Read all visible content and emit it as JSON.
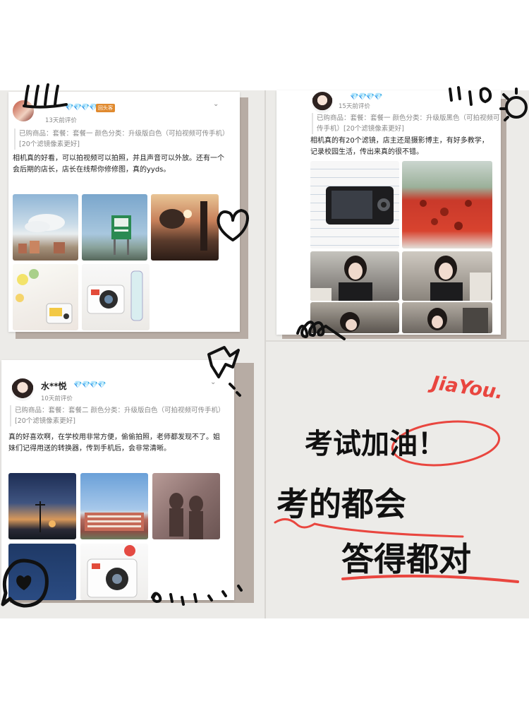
{
  "reviews": [
    {
      "user": "",
      "badge": "回头客",
      "time": "13天前评价",
      "specs": "已购商品：套餐：套餐一    颜色分类：升级版白色（可拍视频可传手机）[20个滤镜像素更好]",
      "text": "相机真的好看，可以拍视频可以拍照，并且声音可以外放。还有一个会后期的店长，店长在线帮你修修图，真的yyds。"
    },
    {
      "user": "",
      "time": "15天前评价",
      "specs": "已购商品：套餐：套餐一    颜色分类：升级版黑色（可拍视频可传手机）[20个滤镜像素更好]",
      "text": "相机真的有20个滤镜，店主还是摄影博主，有好多教学，记录校园生活，传出来真的很不错。"
    },
    {
      "user": "水**悦",
      "time": "10天前评价",
      "specs": "已购商品：套餐：套餐二    颜色分类：升级版白色（可拍视频可传手机）[20个滤镜像素更好]",
      "text": "真的好喜欢啊，在学校用非常方便，偷偷拍照，老师都发现不了。姐妹们记得用送的转换器，传到手机后，会非常清晰。"
    }
  ],
  "diamonds": "💎💎💎💎",
  "chevron": "⌄",
  "slogan": {
    "jiayou": "JiaYou.",
    "line1": "考试加油！",
    "line2": "考的都会",
    "line3": "答得都对"
  },
  "colors": {
    "accent": "#e9463f",
    "bg": "#ecebe8",
    "shadow": "#b7aca4"
  }
}
